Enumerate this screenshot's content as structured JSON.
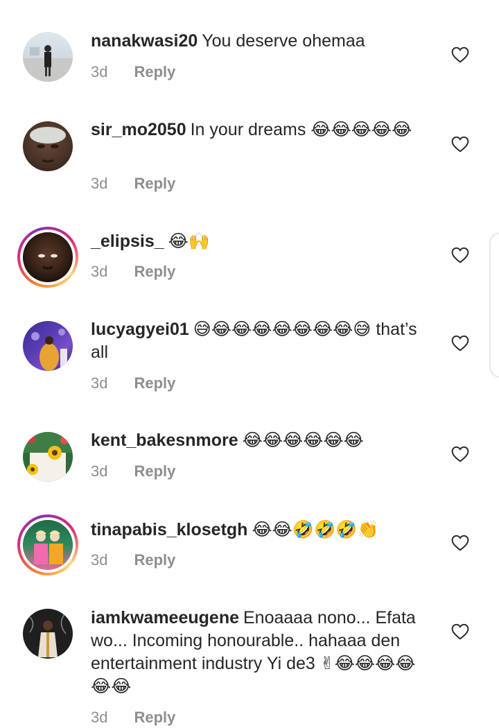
{
  "comments": [
    {
      "user": "nanakwasi20",
      "text": "You deserve ohemaa",
      "time": "3d",
      "reply": "Reply",
      "story": false
    },
    {
      "user": "sir_mo2050",
      "text": "In your dreams 😂😂😂😂😂",
      "time": "3d",
      "reply": "Reply",
      "story": false
    },
    {
      "user": "_elipsis_",
      "text": "😂🙌",
      "time": "3d",
      "reply": "Reply",
      "story": true
    },
    {
      "user": "lucyagyei01",
      "text": "😅😂😂😂😂😂😂😂😅 that’s all",
      "time": "3d",
      "reply": "Reply",
      "story": false
    },
    {
      "user": "kent_bakesnmore",
      "text": "😂😂😂😂😂😂",
      "time": "3d",
      "reply": "Reply",
      "story": false
    },
    {
      "user": "tinapabis_klosetgh",
      "text": "😂😂🤣🤣🤣👏",
      "time": "3d",
      "reply": "Reply",
      "story": true
    },
    {
      "user": "iamkwameeugene",
      "text": "Enoaaaa nono... Efata wo... Incoming honourable.. hahaaa den entertainment industry Yi de3 ✌😂😂😂😂😂😂",
      "time": "3d",
      "reply": "Reply",
      "story": false
    }
  ],
  "icons": {
    "like": "heart-outline-icon"
  },
  "colors": {
    "text": "#262626",
    "muted": "#8e8e8e",
    "story_ring": "#dd2a7b"
  }
}
